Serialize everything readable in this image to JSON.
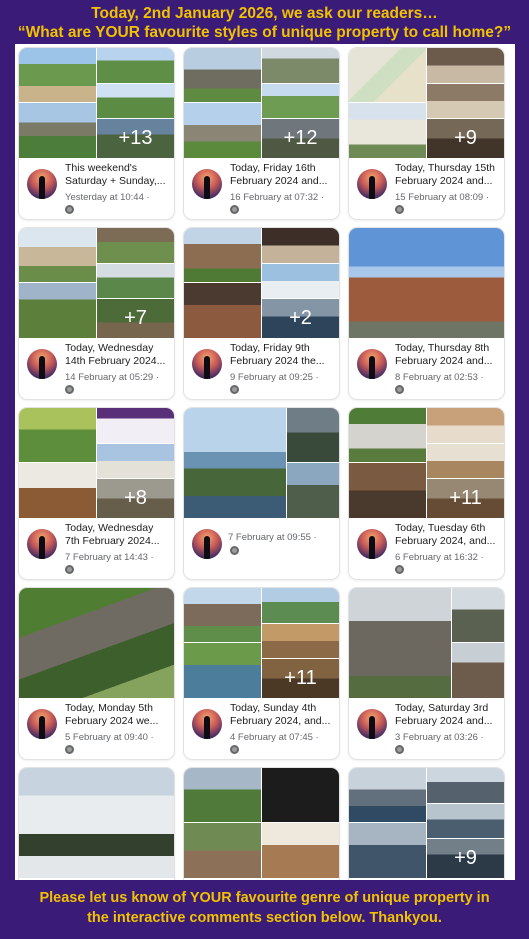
{
  "header": {
    "line1": "Today, 2nd January 2026, we ask our readers…",
    "line2": "“What are YOUR favourite styles of unique property to call home?”"
  },
  "footer": {
    "line1": "Please let us know of YOUR favourite genre of unique property in",
    "line2": "the interactive comments section below. Thankyou."
  },
  "posts": [
    {
      "title": "This weekend's\nSaturday + Sunday,...",
      "time": "Yesterday at 10:44 ·",
      "more": "+13"
    },
    {
      "title": "Today, Friday 16th\nFebruary 2024 and...",
      "time": "16 February at 07:32 ·",
      "more": "+12"
    },
    {
      "title": "Today, Thursday 15th\nFebruary 2024 and...",
      "time": "15 February at 08:09 ·",
      "more": "+9"
    },
    {
      "title": "Today, Wednesday\n14th February 2024...",
      "time": "14 February at 05:29 ·",
      "more": "+7"
    },
    {
      "title": "Today, Friday 9th\nFebruary 2024 the...",
      "time": "9 February at 09:25 ·",
      "more": "+2"
    },
    {
      "title": "Today, Thursday 8th\nFebruary 2024 and...",
      "time": "8 February at 02:53 ·",
      "more": ""
    },
    {
      "title": "Today, Wednesday\n7th February 2024...",
      "time": "7 February at 14:43 ·",
      "more": "+8"
    },
    {
      "title": "",
      "time": "7 February at 09:55 ·",
      "more": ""
    },
    {
      "title": "Today, Tuesday 6th\nFebruary 2024, and...",
      "time": "6 February at 16:32 ·",
      "more": "+11"
    },
    {
      "title": "Today, Monday 5th\nFebruary 2024 we...",
      "time": "5 February at 09:40 ·",
      "more": ""
    },
    {
      "title": "Today, Sunday 4th\nFebruary 2024, and...",
      "time": "4 February at 07:45 ·",
      "more": "+11"
    },
    {
      "title": "Today, Saturday 3rd\nFebruary 2024 and...",
      "time": "3 February at 03:26 ·",
      "more": ""
    },
    {
      "title": "",
      "time": "",
      "more": ""
    },
    {
      "title": "",
      "time": "",
      "more": ""
    },
    {
      "title": "",
      "time": "",
      "more": "+9"
    }
  ],
  "colors": {
    "banner_bg": "#3a1b78",
    "banner_text": "#f2c200",
    "card_bg": "#ffffff",
    "meta_text": "#65676b"
  }
}
